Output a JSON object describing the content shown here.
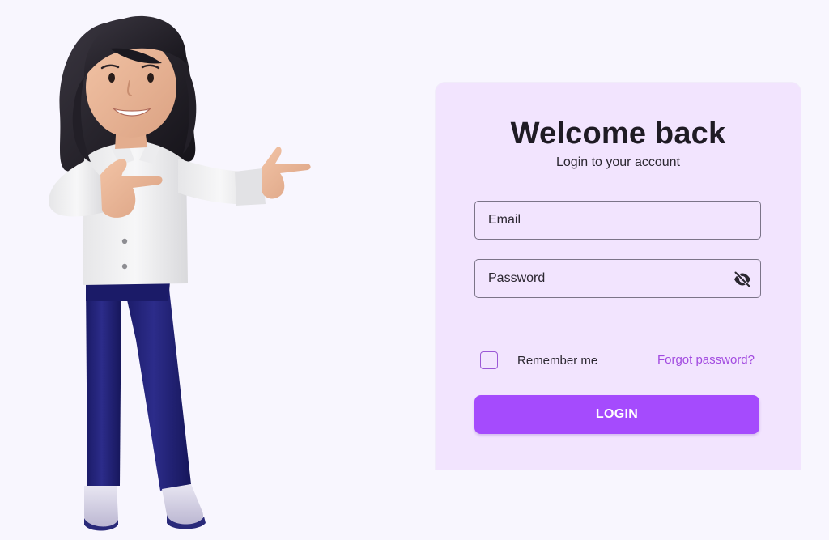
{
  "login": {
    "title": "Welcome back",
    "subtitle": "Login to your account",
    "email_placeholder": "Email",
    "password_placeholder": "Password",
    "remember_label": "Remember me",
    "remember_checked": false,
    "forgot_label": "Forgot password?",
    "login_label": "LOGIN"
  },
  "icons": {
    "password_toggle": "eye-off-icon",
    "illustration": "woman-pointing-illustration"
  },
  "colors": {
    "page_background": "#f8f6fe",
    "card_background": "#f2e4fe",
    "accent": "#a54bfd",
    "link": "#a24ae0",
    "title_text": "#1f1b24"
  }
}
